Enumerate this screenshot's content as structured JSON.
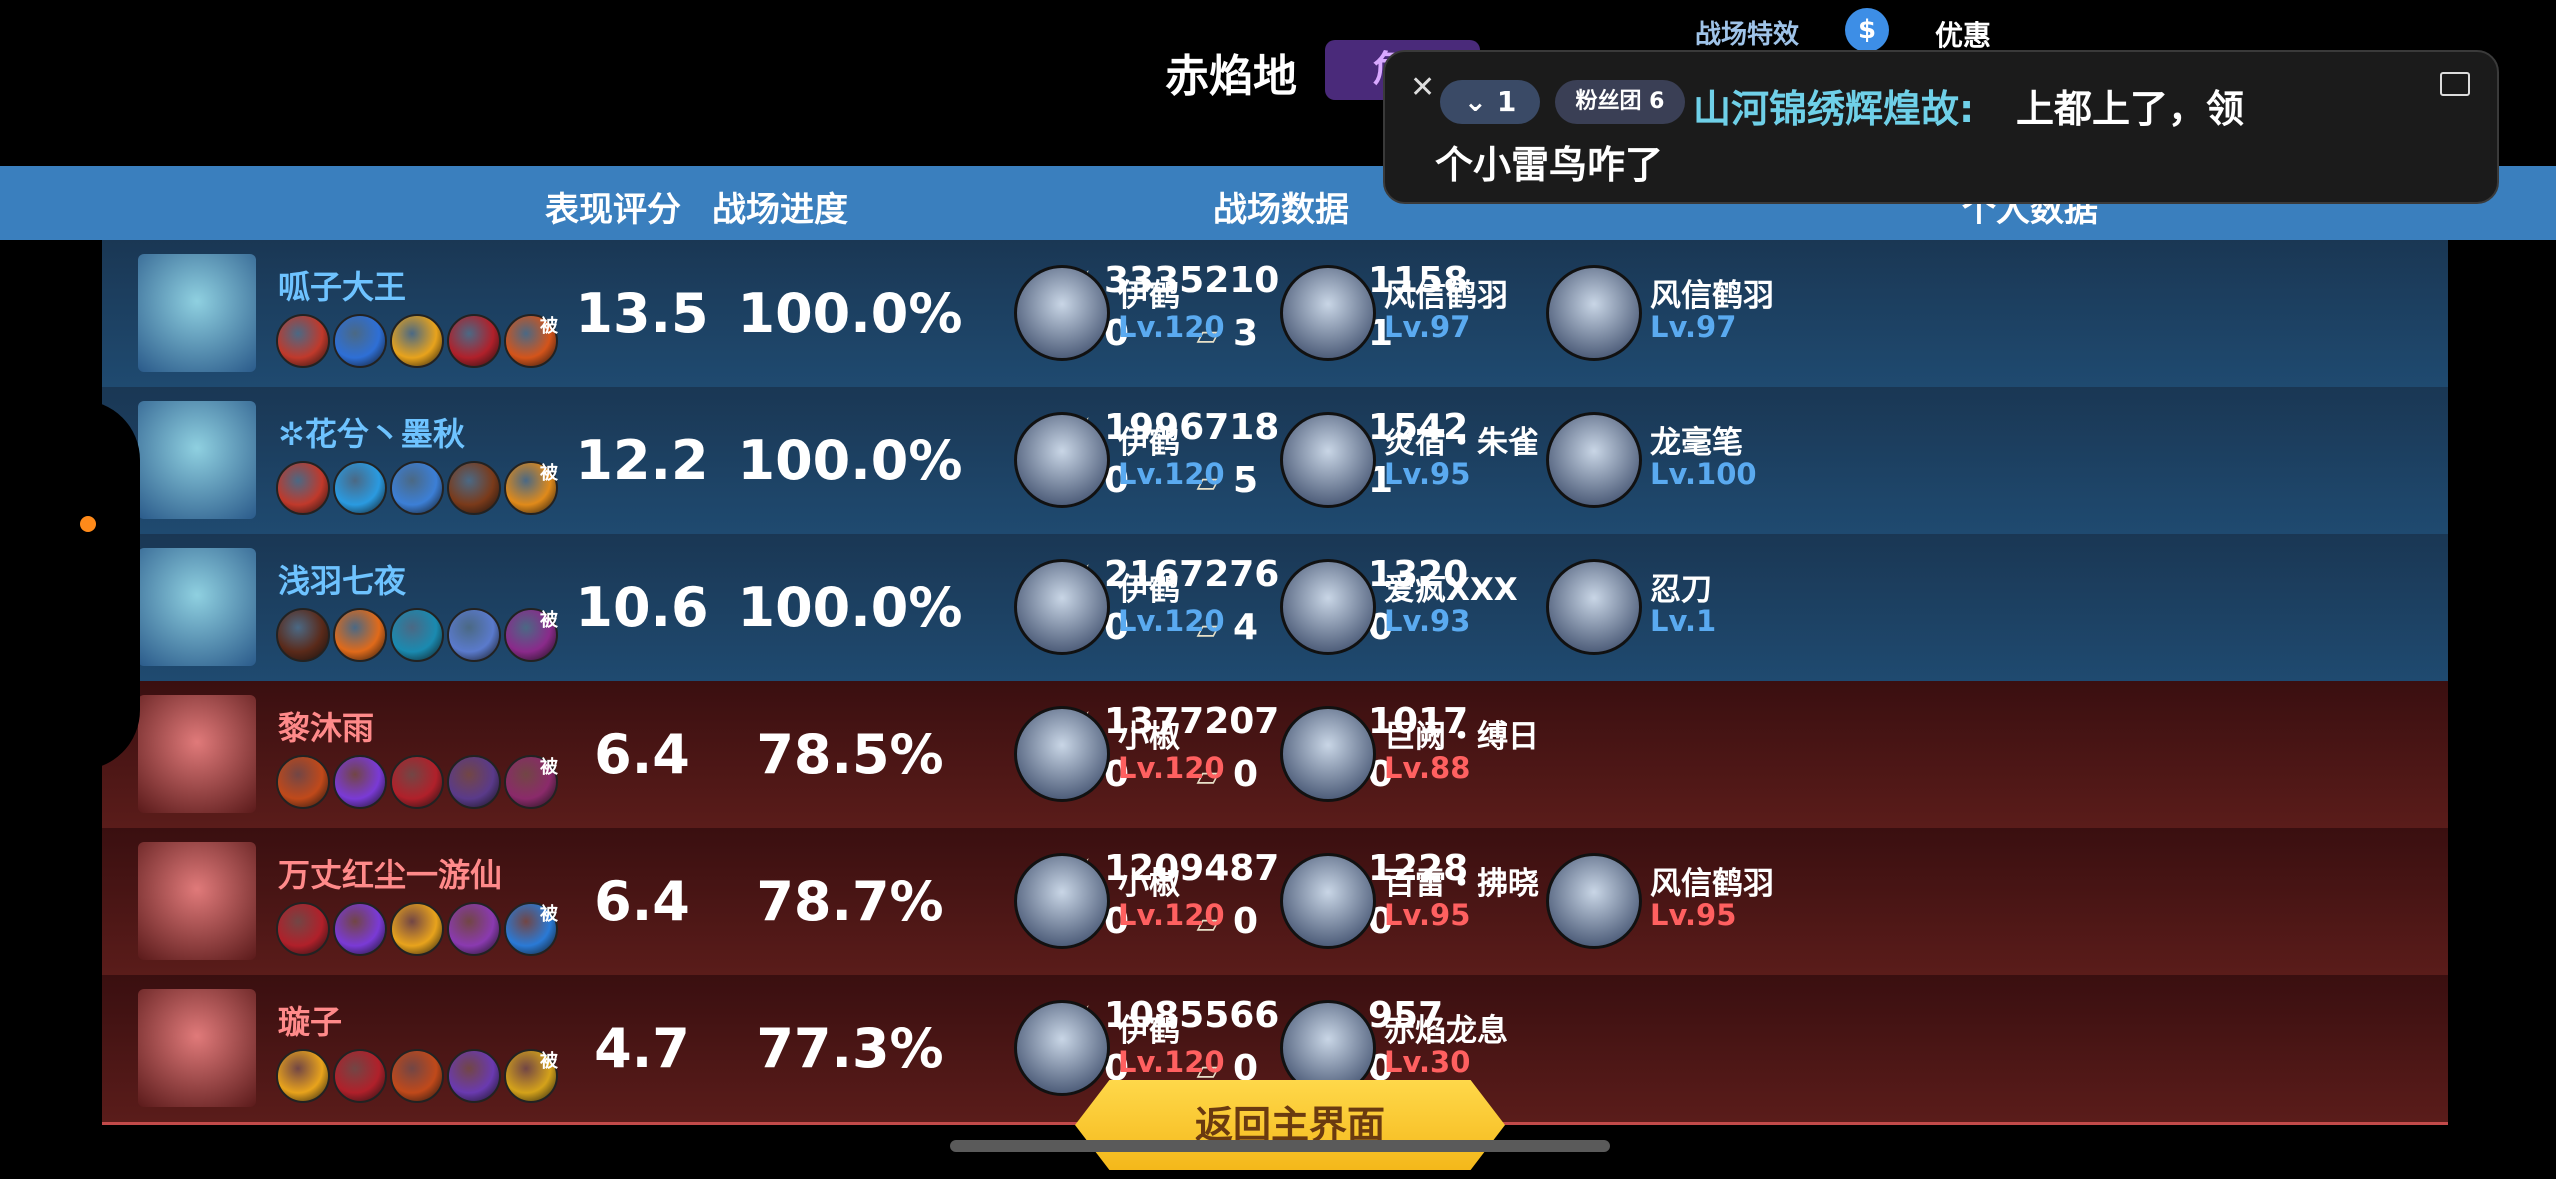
{
  "top": {
    "map_name": "赤焰地",
    "danger_label": "危",
    "battle_effects": "战场特效",
    "coin_symbol": "$",
    "discount": "优惠"
  },
  "header": {
    "score": "表现评分",
    "progress": "战场进度",
    "battle_data": "战场数据",
    "personal_data": "个人数据"
  },
  "chat": {
    "level": "1",
    "fan_badge": "粉丝团 6",
    "user": "山河锦绣辉煌故:",
    "message": "上都上了，领",
    "message2": "个小雷鸟咋了"
  },
  "passive_tag": "被",
  "return_button": "返回主界面",
  "rows": [
    {
      "team": "blue",
      "name": "呱子大王",
      "score": "13.5",
      "progress": "100.0%",
      "damage": "3335210",
      "heal": "1158",
      "kills": "0",
      "books": "3",
      "chests": "1",
      "chars": [
        {
          "name": "伊鹤",
          "lv": "Lv.120"
        },
        {
          "name": "风信鹤羽",
          "lv": "Lv.97"
        },
        {
          "name": "风信鹤羽",
          "lv": "Lv.97"
        }
      ],
      "skills": [
        "#c0392b",
        "#2e6fd6",
        "#e8a31c",
        "#b0202a",
        "#d4541a"
      ]
    },
    {
      "team": "blue",
      "name": "✲花兮丶墨秋",
      "score": "12.2",
      "progress": "100.0%",
      "damage": "1996718",
      "heal": "1542",
      "kills": "0",
      "books": "5",
      "chests": "1",
      "chars": [
        {
          "name": "伊鹤",
          "lv": "Lv.120"
        },
        {
          "name": "炎宿・朱雀",
          "lv": "Lv.95"
        },
        {
          "name": "龙毫笔",
          "lv": "Lv.100"
        }
      ],
      "skills": [
        "#c0392b",
        "#2a9ae0",
        "#3c7fd6",
        "#7a3a1a",
        "#e08a1a"
      ]
    },
    {
      "team": "blue",
      "name": "浅羽七夜",
      "score": "10.6",
      "progress": "100.0%",
      "damage": "2167276",
      "heal": "1320",
      "kills": "0",
      "books": "4",
      "chests": "0",
      "chars": [
        {
          "name": "伊鹤",
          "lv": "Lv.120"
        },
        {
          "name": "爱疯XXX",
          "lv": "Lv.93"
        },
        {
          "name": "忍刀",
          "lv": "Lv.1"
        }
      ],
      "skills": [
        "#5a2a1a",
        "#e06a1a",
        "#1a8ab0",
        "#5a7acc",
        "#8a2a8a"
      ]
    },
    {
      "team": "red",
      "name": "黎沐雨",
      "score": "6.4",
      "progress": "78.5%",
      "damage": "1377207",
      "heal": "1017",
      "kills": "0",
      "books": "0",
      "chests": "0",
      "chars": [
        {
          "name": "小椒",
          "lv": "Lv.120"
        },
        {
          "name": "巨阙・缚日",
          "lv": "Lv.88"
        }
      ],
      "skills": [
        "#c0491a",
        "#7a3ad6",
        "#b0202a",
        "#5a3a8a",
        "#8a2a6a"
      ]
    },
    {
      "team": "red",
      "name": "万丈红尘一游仙",
      "score": "6.4",
      "progress": "78.7%",
      "damage": "1209487",
      "heal": "1228",
      "kills": "0",
      "books": "0",
      "chests": "0",
      "chars": [
        {
          "name": "小椒",
          "lv": "Lv.120"
        },
        {
          "name": "百雷・拂晓",
          "lv": "Lv.95"
        },
        {
          "name": "风信鹤羽",
          "lv": "Lv.95"
        }
      ],
      "skills": [
        "#b0202a",
        "#7a3ad6",
        "#e8a31c",
        "#8a3ab0",
        "#2a7ad6"
      ]
    },
    {
      "team": "red",
      "name": "璇子",
      "score": "4.7",
      "progress": "77.3%",
      "damage": "1085566",
      "heal": "957",
      "kills": "0",
      "books": "0",
      "chests": "0",
      "chars": [
        {
          "name": "伊鹤",
          "lv": "Lv.120"
        },
        {
          "name": "赤焰龙息",
          "lv": "Lv.30"
        }
      ],
      "skills": [
        "#e8a31c",
        "#b0202a",
        "#c0491a",
        "#6a3ab0",
        "#d4a21a"
      ]
    }
  ]
}
